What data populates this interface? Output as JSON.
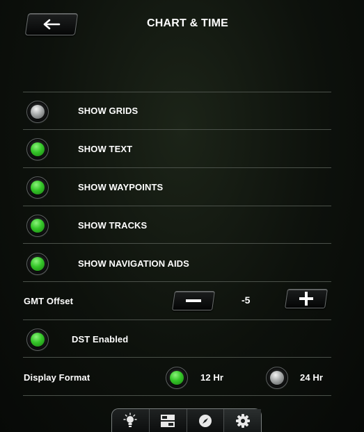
{
  "header": {
    "title": "CHART & TIME",
    "back_icon": "left-arrow-icon"
  },
  "toggles": [
    {
      "label": "SHOW GRIDS",
      "state": "off"
    },
    {
      "label": "SHOW TEXT",
      "state": "on"
    },
    {
      "label": "SHOW WAYPOINTS",
      "state": "on"
    },
    {
      "label": "SHOW TRACKS",
      "state": "on"
    },
    {
      "label": "SHOW NAVIGATION AIDS",
      "state": "on"
    }
  ],
  "gmt": {
    "label": "GMT Offset",
    "value": "-5",
    "minus_icon": "minus-icon",
    "plus_icon": "plus-icon"
  },
  "dst": {
    "label": "DST Enabled",
    "state": "on"
  },
  "display_format": {
    "label": "Display Format",
    "options": [
      {
        "label": "12 Hr",
        "selected": true
      },
      {
        "label": "24 Hr",
        "selected": false
      }
    ]
  },
  "tabbar": {
    "tabs": [
      {
        "icon": "lightbulb-icon",
        "active": false
      },
      {
        "icon": "panels-icon",
        "active": false
      },
      {
        "icon": "compass-icon",
        "active": false
      },
      {
        "icon": "gear-icon",
        "active": true
      }
    ]
  },
  "colors": {
    "accent_on": "#34c528",
    "accent_off": "#a7aaaa",
    "divider": "#4b514a"
  }
}
